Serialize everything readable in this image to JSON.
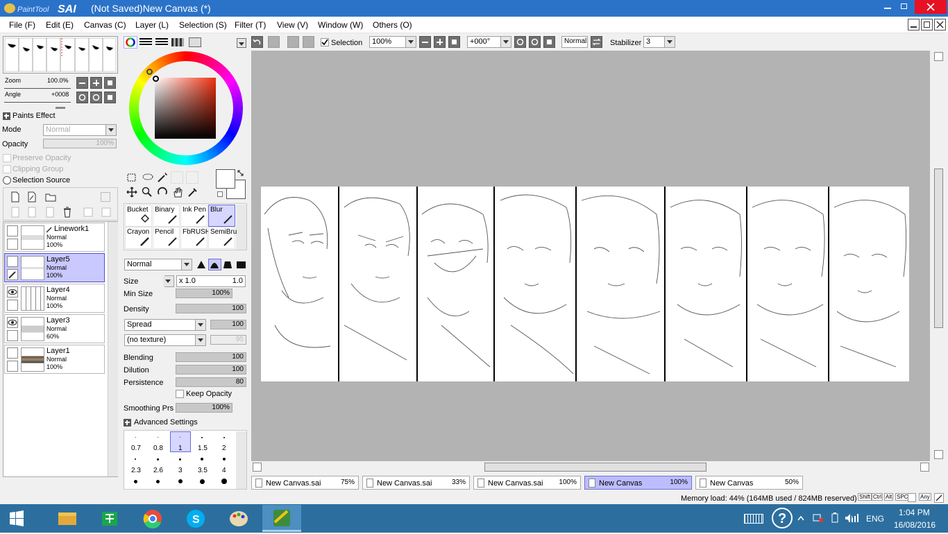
{
  "title": {
    "logo": "PaintTool SAI",
    "text": "(Not Saved)New Canvas (*)"
  },
  "menu": [
    "File (F)",
    "Edit (E)",
    "Canvas (C)",
    "Layer (L)",
    "Selection (S)",
    "Filter (T)",
    "View (V)",
    "Window (W)",
    "Others (O)"
  ],
  "navigator": {
    "zoom_label": "Zoom",
    "zoom_value": "100.0%",
    "angle_label": "Angle",
    "angle_value": "+0008"
  },
  "layer_panel": {
    "paints_effect": "Paints Effect",
    "mode_label": "Mode",
    "mode_value": "Normal",
    "opacity_label": "Opacity",
    "opacity_value": "100%",
    "preserve_opacity": "Preserve Opacity",
    "clipping_group": "Clipping Group",
    "selection_source": "Selection Source"
  },
  "layers": [
    {
      "name": "Linework1",
      "mode": "Normal",
      "opacity": "100%",
      "visible": false,
      "selected": false
    },
    {
      "name": "Layer5",
      "mode": "Normal",
      "opacity": "100%",
      "visible": false,
      "selected": true
    },
    {
      "name": "Layer4",
      "mode": "Normal",
      "opacity": "100%",
      "visible": true,
      "selected": false
    },
    {
      "name": "Layer3",
      "mode": "Normal",
      "opacity": "60%",
      "visible": true,
      "selected": false
    },
    {
      "name": "Layer1",
      "mode": "Normal",
      "opacity": "100%",
      "visible": false,
      "selected": false
    }
  ],
  "tools": [
    {
      "name": "Bucket",
      "selected": false
    },
    {
      "name": "Binary",
      "selected": false
    },
    {
      "name": "Ink Pen",
      "selected": false
    },
    {
      "name": "Blur",
      "selected": true
    },
    {
      "name": "Crayon",
      "selected": false
    },
    {
      "name": "Pencil",
      "selected": false
    },
    {
      "name": "FbRUSH",
      "selected": false
    },
    {
      "name": "SemiBru",
      "selected": false
    }
  ],
  "brush": {
    "blend_mode": "Normal",
    "size_label": "Size",
    "size_mult": "x 1.0",
    "size_value": "1.0",
    "min_size_label": "Min Size",
    "min_size_value": "100%",
    "density_label": "Density",
    "density_value": "100",
    "spread": "Spread",
    "spread_value": "100",
    "texture": "(no texture)",
    "texture_value": "95",
    "blending_label": "Blending",
    "blending_value": "100",
    "dilution_label": "Dilution",
    "dilution_value": "100",
    "persistence_label": "Persistence",
    "persistence_value": "80",
    "keep_opacity": "Keep Opacity",
    "smoothing_label": "Smoothing Prs",
    "smoothing_value": "100%",
    "advanced": "Advanced Settings",
    "sizes_row1": [
      "0.7",
      "0.8",
      "1",
      "1.5",
      "2"
    ],
    "sizes_row2": [
      "2.3",
      "2.6",
      "3",
      "3.5",
      "4"
    ]
  },
  "toolbar": {
    "selection_label": "Selection",
    "zoom": "100%",
    "angle": "+000°",
    "mode": "Normal",
    "stabilizer_label": "Stabilizer",
    "stabilizer_value": "3"
  },
  "tabs": [
    {
      "name": "New Canvas.sai",
      "zoom": "75%",
      "selected": false
    },
    {
      "name": "New Canvas.sai",
      "zoom": "33%",
      "selected": false
    },
    {
      "name": "New Canvas.sai",
      "zoom": "100%",
      "selected": false
    },
    {
      "name": "New Canvas",
      "zoom": "100%",
      "selected": true
    },
    {
      "name": "New Canvas",
      "zoom": "50%",
      "selected": false
    }
  ],
  "status": {
    "memory": "Memory load: 44% (164MB used / 824MB reserved)",
    "keys": [
      "Shift",
      "Ctrl",
      "Alt",
      "SPC",
      "Any"
    ]
  },
  "taskbar": {
    "lang": "ENG",
    "time": "1:04 PM",
    "date": "16/08/2016"
  },
  "colors": {
    "title_bar": "#2b73c9",
    "selected_layer": "#c9c9ff",
    "taskbar": "#2c6f9f",
    "canvas_bg": "#b3b3b3",
    "close_button": "#e81123"
  }
}
